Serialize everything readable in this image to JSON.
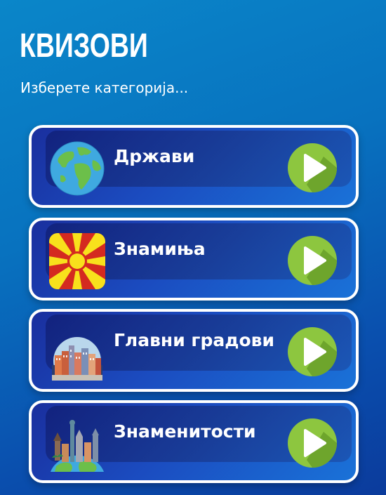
{
  "header": {
    "title": "КВИЗОВИ",
    "subtitle": "Изберете категорија..."
  },
  "categories": [
    {
      "label": "Држави",
      "icon": "globe-icon"
    },
    {
      "label": "Знамиња",
      "icon": "macedonia-flag-icon"
    },
    {
      "label": "Главни градови",
      "icon": "city-skyline-icon"
    },
    {
      "label": "Знаменитости",
      "icon": "landmarks-globe-icon"
    }
  ],
  "colors": {
    "background_top": "#0a86c9",
    "background_bottom": "#0b3b9c",
    "card_border": "#ffffff",
    "play_button": "#8dc63f"
  }
}
